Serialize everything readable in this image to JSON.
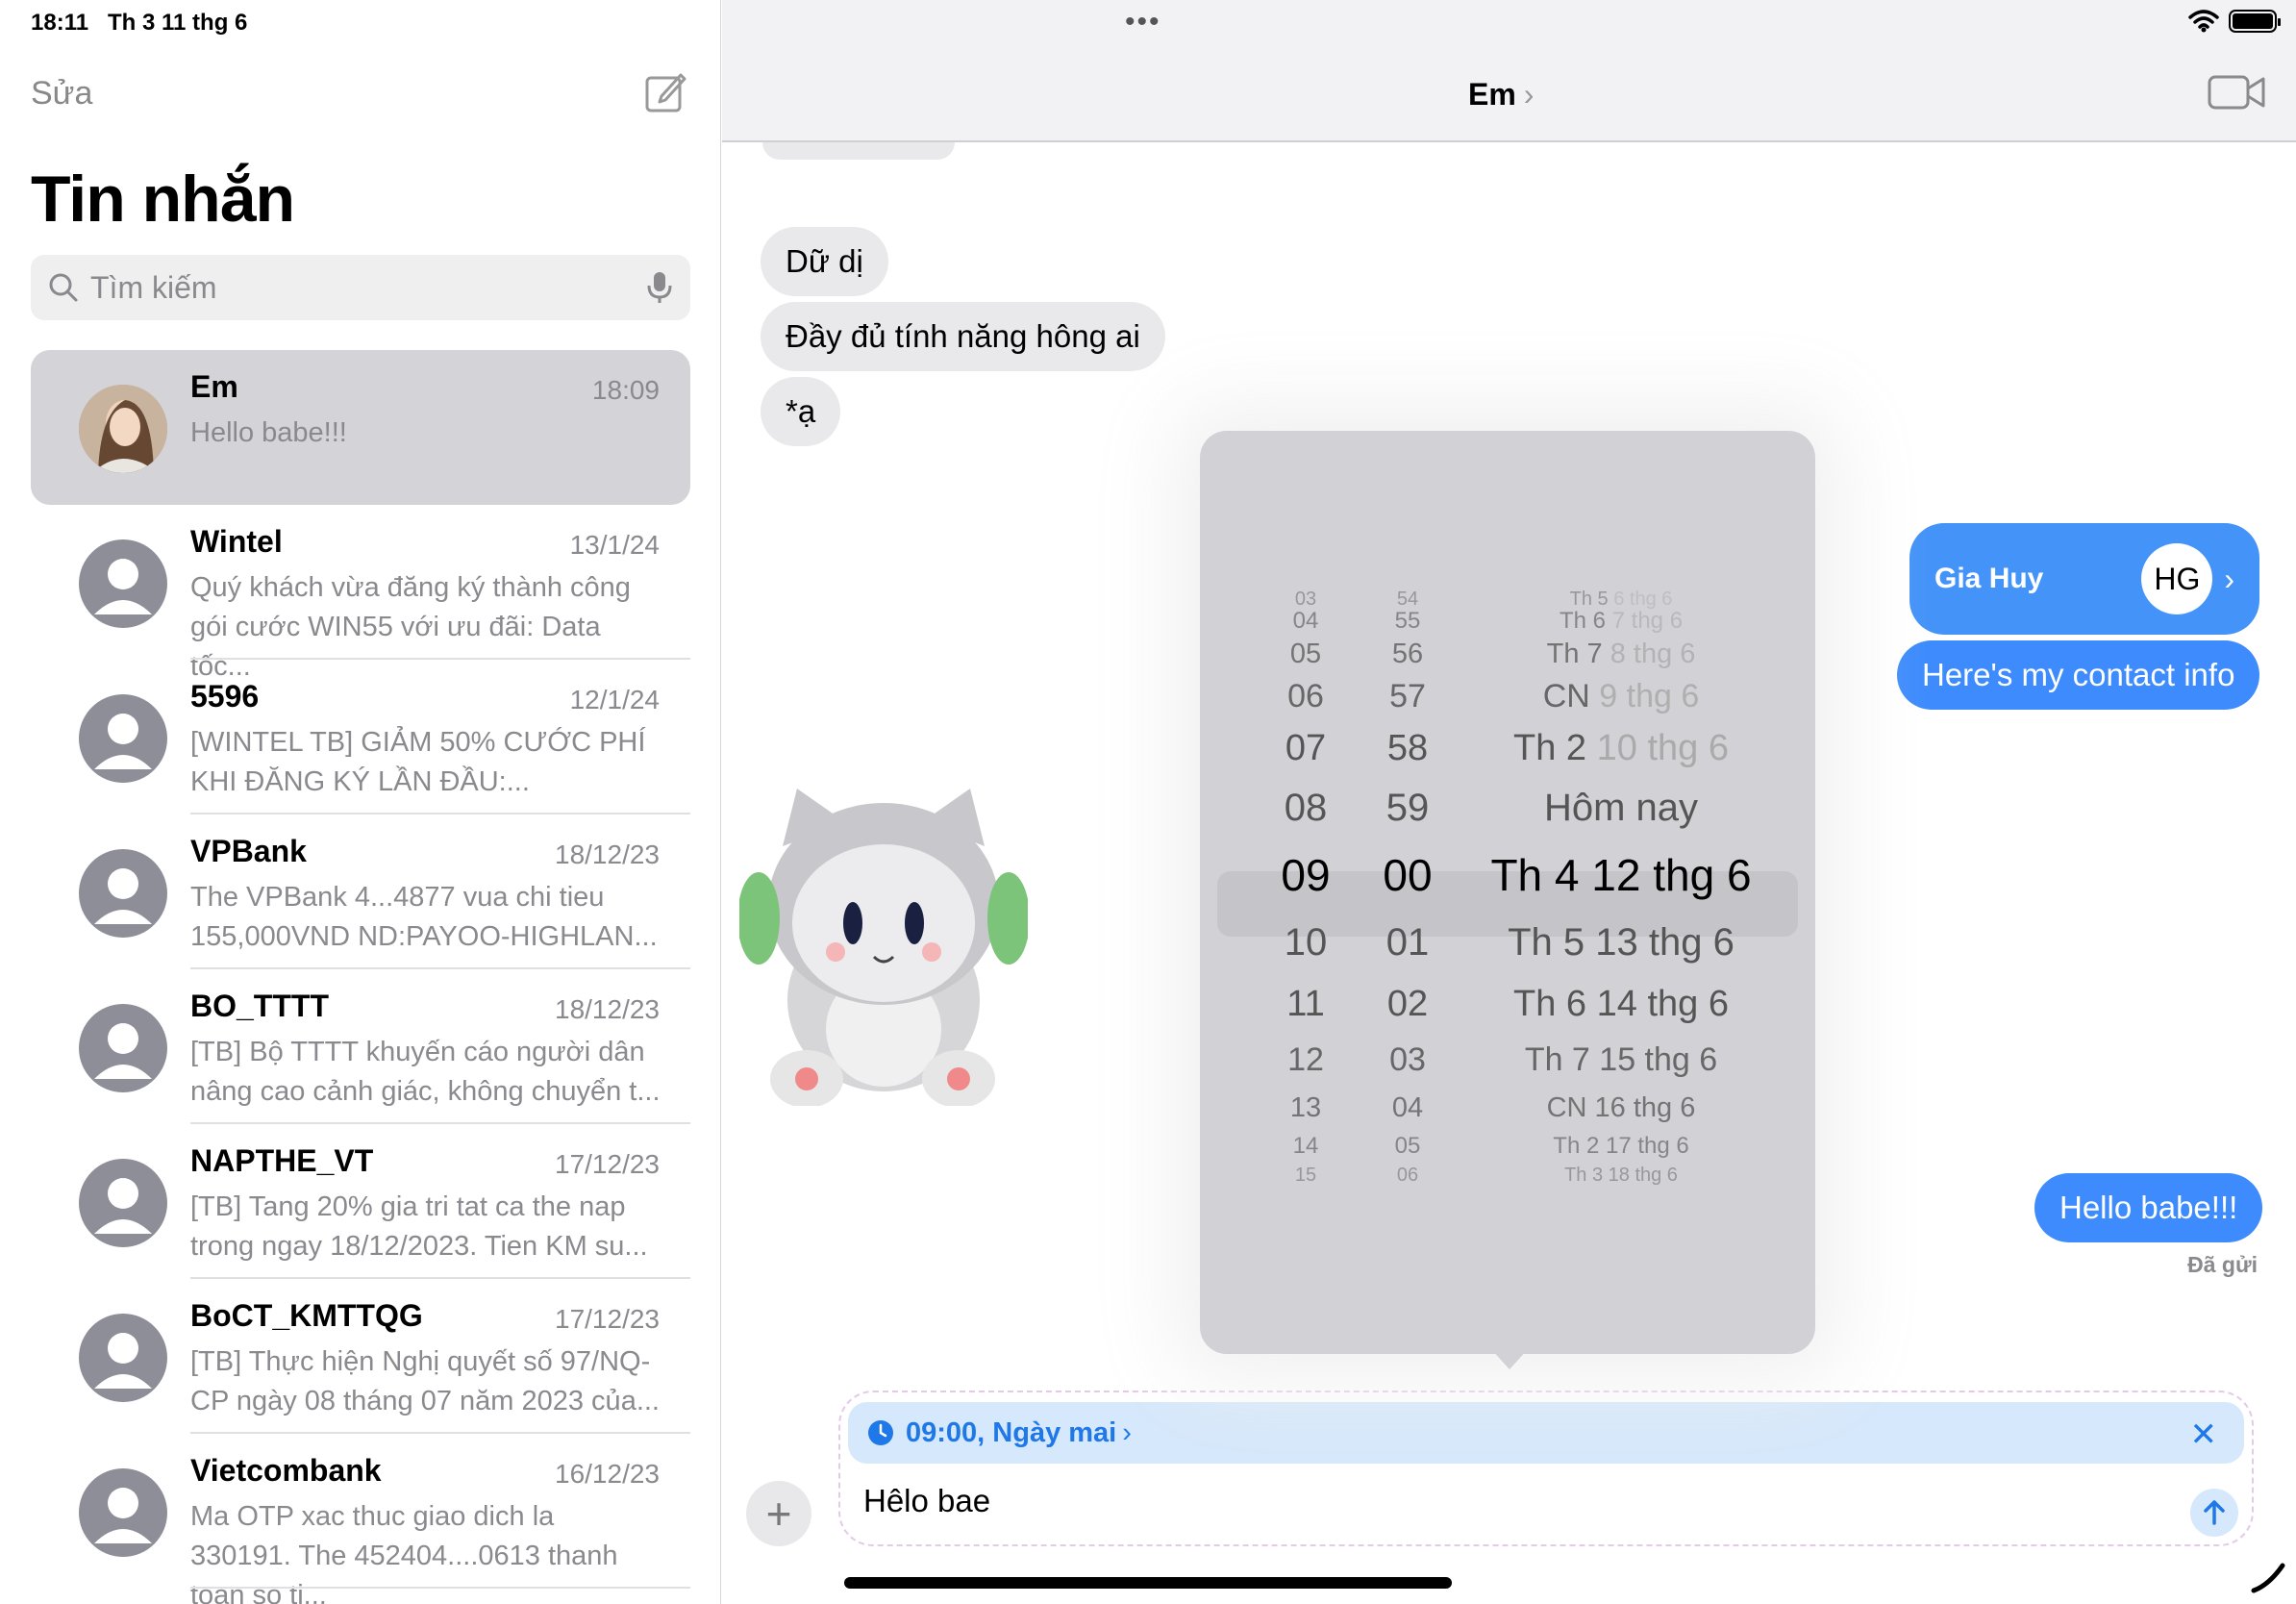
{
  "status": {
    "time": "18:11",
    "date": "Th 3 11 thg 6"
  },
  "sidebar": {
    "edit_label": "Sửa",
    "title": "Tin nhắn",
    "search_placeholder": "Tìm kiếm",
    "conversations": [
      {
        "name": "Em",
        "date": "18:09",
        "preview": "Hello babe!!!",
        "selected": true
      },
      {
        "name": "Wintel",
        "date": "13/1/24",
        "preview": "Quý khách vừa đăng ký thành công gói cước WIN55 với ưu đãi: Data tốc..."
      },
      {
        "name": "5596",
        "date": "12/1/24",
        "preview": "[WINTEL TB] GIẢM 50% CƯỚC PHÍ KHI ĐĂNG KÝ LẦN ĐẦU:..."
      },
      {
        "name": "VPBank",
        "date": "18/12/23",
        "preview": "The VPBank 4...4877 vua chi tieu 155,000VND ND:PAYOO-HIGHLAN..."
      },
      {
        "name": "BO_TTTT",
        "date": "18/12/23",
        "preview": "[TB] Bộ TTTT khuyến cáo người dân nâng cao cảnh giác, không chuyển t..."
      },
      {
        "name": "NAPTHE_VT",
        "date": "17/12/23",
        "preview": "[TB] Tang 20% gia tri tat ca the nap trong ngay 18/12/2023. Tien KM su..."
      },
      {
        "name": "BoCT_KMTTQG",
        "date": "17/12/23",
        "preview": "[TB] Thực hiện Nghị quyết số 97/NQ-CP ngày 08 tháng 07 năm 2023 của..."
      },
      {
        "name": "Vietcombank",
        "date": "16/12/23",
        "preview": "Ma OTP xac thuc giao dich la 330191. The 452404....0613 thanh toan so ti..."
      }
    ]
  },
  "chat": {
    "title": "Em",
    "title_chevron": "›",
    "incoming": [
      "Dữ dị",
      "Đầy đủ tính năng hông ai",
      "*ạ"
    ],
    "contact_card": {
      "name": "Gia Huy",
      "initials": "HG",
      "chevron": "›"
    },
    "outgoing": [
      "Here's my contact info",
      "Hello babe!!!"
    ],
    "sent_status": "Đã gửi"
  },
  "picker": {
    "rows": [
      {
        "h": "04",
        "m": "55",
        "d": "Th 6",
        "dm": "7 thg 6"
      },
      {
        "h": "05",
        "m": "56",
        "d": "Th 7",
        "dm": "8 thg 6"
      },
      {
        "h": "06",
        "m": "57",
        "d": "CN",
        "dm": "9 thg 6"
      },
      {
        "h": "07",
        "m": "58",
        "d": "Th 2",
        "dm": "10 thg 6"
      },
      {
        "h": "08",
        "m": "59",
        "d": "Hôm nay",
        "dm": ""
      },
      {
        "h": "09",
        "m": "00",
        "d": "Th 4 12 thg 6",
        "dm": ""
      },
      {
        "h": "10",
        "m": "01",
        "d": "Th 5 13 thg 6",
        "dm": ""
      },
      {
        "h": "11",
        "m": "02",
        "d": "Th 6 14 thg 6",
        "dm": ""
      },
      {
        "h": "12",
        "m": "03",
        "d": "Th 7 15 thg 6",
        "dm": ""
      },
      {
        "h": "13",
        "m": "04",
        "d": "CN 16 thg 6",
        "dm": ""
      },
      {
        "h": "14",
        "m": "05",
        "d": "Th 2 17 thg 6",
        "dm": ""
      },
      {
        "h": "15",
        "m": "06",
        "d": "Th 3 18 thg 6",
        "dm": ""
      }
    ],
    "top_faded": {
      "h": "03",
      "m": "54",
      "d": "Th 5",
      "dm": "6 thg 6"
    }
  },
  "compose": {
    "schedule_label": "09:00, Ngày mai",
    "schedule_chevron": "›",
    "close_label": "✕",
    "message_text": "Hêlo bae",
    "plus_label": "+"
  },
  "colors": {
    "accent": "#3d8bfd",
    "schedule_bg": "#d6e8fb",
    "picker_bg": "#d1d1d6"
  }
}
